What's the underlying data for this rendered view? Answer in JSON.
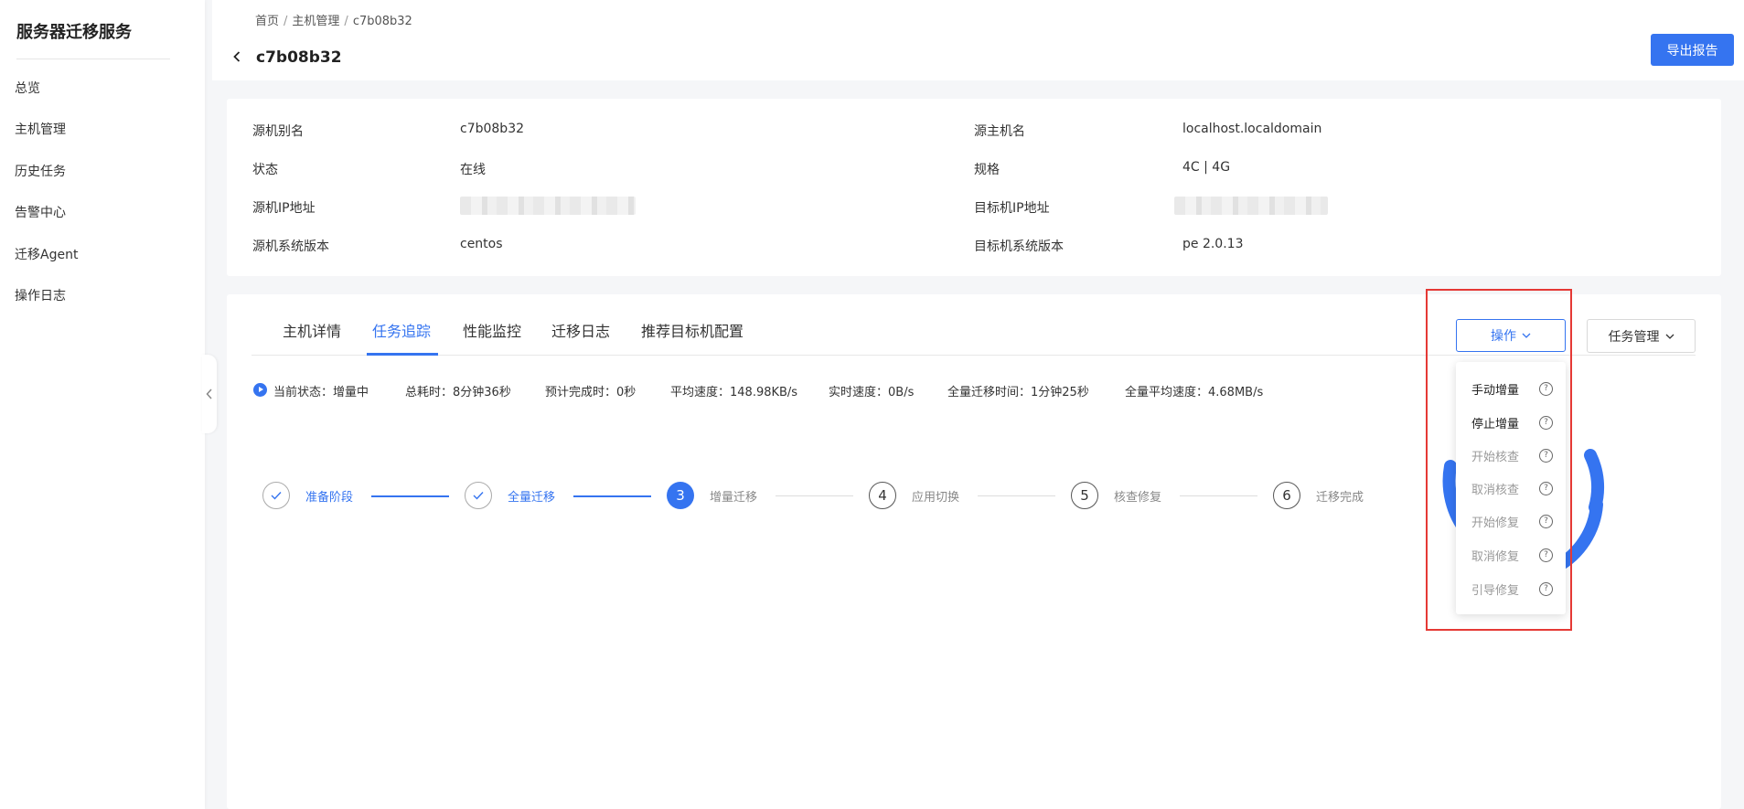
{
  "sidebar": {
    "title": "服务器迁移服务",
    "items": [
      {
        "label": "总览"
      },
      {
        "label": "主机管理"
      },
      {
        "label": "历史任务"
      },
      {
        "label": "告警中心"
      },
      {
        "label": "迁移Agent"
      },
      {
        "label": "操作日志"
      }
    ]
  },
  "breadcrumb": [
    "首页",
    "主机管理",
    "c7b08b32"
  ],
  "header": {
    "title": "c7b08b32",
    "export_label": "导出报告"
  },
  "info": {
    "left": [
      {
        "label": "源机别名",
        "value": "c7b08b32"
      },
      {
        "label": "状态",
        "value": "在线"
      },
      {
        "label": "源机IP地址",
        "value": ""
      },
      {
        "label": "源机系统版本",
        "value": "centos"
      }
    ],
    "right": [
      {
        "label": "源主机名",
        "value": "localhost.localdomain"
      },
      {
        "label": "规格",
        "value": "4C | 4G"
      },
      {
        "label": "目标机IP地址",
        "value": ""
      },
      {
        "label": "目标机系统版本",
        "value": "pe 2.0.13"
      }
    ]
  },
  "tabs": [
    {
      "label": "主机详情"
    },
    {
      "label": "任务追踪",
      "active": true
    },
    {
      "label": "性能监控"
    },
    {
      "label": "迁移日志"
    },
    {
      "label": "推荐目标机配置"
    }
  ],
  "actions": {
    "operate_label": "操作",
    "task_manage_label": "任务管理"
  },
  "status": {
    "current": "当前状态：增量中",
    "total_time": "总耗时：8分钟36秒",
    "eta": "预计完成时：0秒",
    "avg_speed": "平均速度：148.98KB/s",
    "realtime_speed": "实时速度：0B/s",
    "full_time": "全量迁移时间：1分钟25秒",
    "full_avg_speed": "全量平均速度：4.68MB/s"
  },
  "steps": [
    {
      "num": "1",
      "label": "准备阶段",
      "state": "done"
    },
    {
      "num": "2",
      "label": "全量迁移",
      "state": "done"
    },
    {
      "num": "3",
      "label": "增量迁移",
      "state": "active"
    },
    {
      "num": "4",
      "label": "应用切换",
      "state": "todo"
    },
    {
      "num": "5",
      "label": "核查修复",
      "state": "todo"
    },
    {
      "num": "6",
      "label": "迁移完成",
      "state": "todo"
    }
  ],
  "dropdown": [
    {
      "label": "手动增量",
      "enabled": true
    },
    {
      "label": "停止增量",
      "enabled": true
    },
    {
      "label": "开始核查",
      "enabled": false
    },
    {
      "label": "取消核查",
      "enabled": false
    },
    {
      "label": "开始修复",
      "enabled": false
    },
    {
      "label": "取消修复",
      "enabled": false
    },
    {
      "label": "引导修复",
      "enabled": false
    }
  ],
  "colors": {
    "accent": "#3574f0",
    "highlight": "#e53935"
  }
}
